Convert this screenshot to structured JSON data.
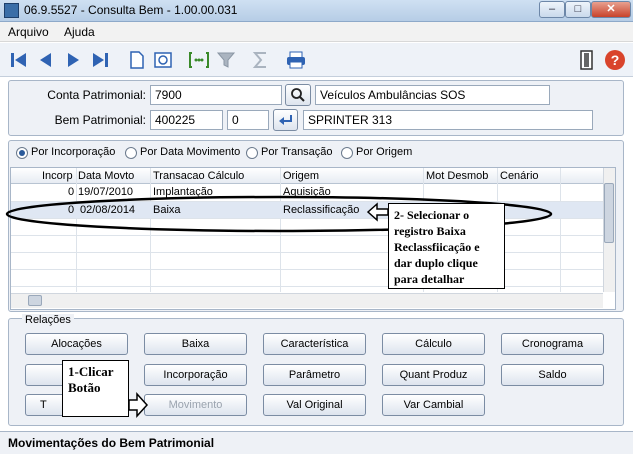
{
  "window": {
    "title": "06.9.5527 - Consulta Bem - 1.00.00.031"
  },
  "menu": [
    {
      "label": "Arquivo"
    },
    {
      "label": "Ajuda"
    }
  ],
  "form": {
    "conta_label": "Conta Patrimonial:",
    "conta_value": "7900",
    "conta_desc": "Veículos Ambulâncias SOS",
    "bem_label": "Bem Patrimonial:",
    "bem_value": "400225",
    "bem_seq": "0",
    "bem_desc": "SPRINTER 313"
  },
  "radios": [
    {
      "label": "Por Incorporação",
      "selected": true
    },
    {
      "label": "Por Data Movimento",
      "selected": false
    },
    {
      "label": "Por Transação",
      "selected": false
    },
    {
      "label": "Por Origem",
      "selected": false
    }
  ],
  "grid": {
    "columns": [
      "Incorp",
      "Data Movto",
      "Transacao Cálculo",
      "Origem",
      "Mot Desmob",
      "Cenário"
    ],
    "rows": [
      [
        "0",
        "19/07/2010",
        "Implantação",
        "Aquisição",
        "",
        ""
      ],
      [
        "0",
        "02/08/2014",
        "Baixa",
        "Reclassificação",
        "",
        ""
      ]
    ]
  },
  "relacoes": {
    "title": "Relações",
    "buttons": {
      "alocacoes": "Alocações",
      "baixa": "Baixa",
      "caracteristica": "Característica",
      "calculo": "Cálculo",
      "cronograma": "Cronograma",
      "incorporacao": "Incorporação",
      "parametro": "Parâmetro",
      "quant_produz": "Quant Produz",
      "saldo": "Saldo",
      "t_partial": "T",
      "movimento": "Movimento",
      "val_original": "Val Original",
      "var_cambial": "Var Cambial"
    }
  },
  "annotations": {
    "callout1": "1-Clicar Botão",
    "callout2": "2- Selecionar o registro Baixa Reclassfiicação e dar duplo clique para detalhar"
  },
  "status": "Movimentações do Bem Patrimonial",
  "colors": {
    "accent": "#2a5a9a",
    "toolbar_blue": "#2f63b3",
    "close_red": "#d9442c"
  }
}
